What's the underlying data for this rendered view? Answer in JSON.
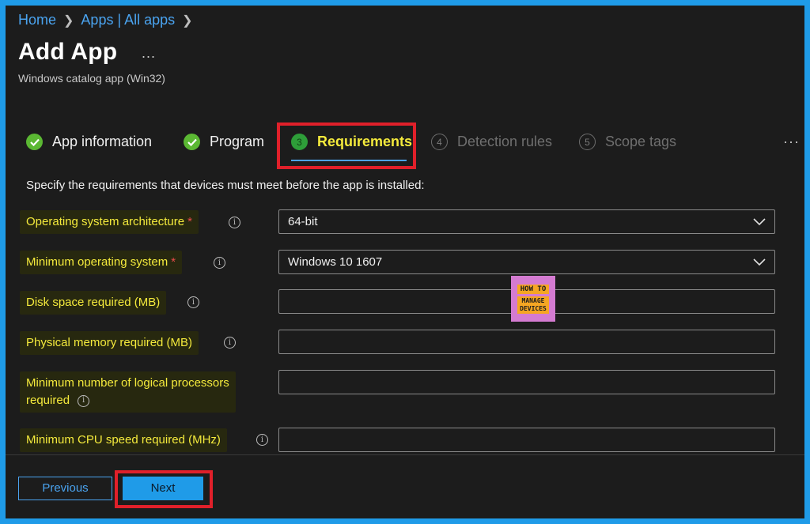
{
  "breadcrumb": {
    "home": "Home",
    "apps": "Apps | All apps"
  },
  "page": {
    "title": "Add App",
    "more": "...",
    "subtitle": "Windows catalog app (Win32)"
  },
  "tabs": [
    {
      "label": "App information",
      "state": "done"
    },
    {
      "label": "Program",
      "state": "done"
    },
    {
      "number": "3",
      "label": "Requirements",
      "state": "active"
    },
    {
      "number": "4",
      "label": "Detection rules",
      "state": "disabled"
    },
    {
      "number": "5",
      "label": "Scope tags",
      "state": "disabled"
    }
  ],
  "tabs_more": "···",
  "instructions": "Specify the requirements that devices must meet before the app is installed:",
  "fields": {
    "os_arch": {
      "label": "Operating system architecture",
      "required": "*",
      "value": "64-bit"
    },
    "min_os": {
      "label": "Minimum operating system",
      "required": "*",
      "value": "Windows 10 1607"
    },
    "disk_space": {
      "label": "Disk space required (MB)",
      "value": ""
    },
    "physical_memory": {
      "label": "Physical memory required (MB)",
      "value": ""
    },
    "logical_processors": {
      "label_line1": "Minimum number of logical processors",
      "label_line2": "required",
      "value": ""
    },
    "cpu_speed": {
      "label": "Minimum CPU speed required (MHz)",
      "value": ""
    }
  },
  "watermark": {
    "line1": "HOW TO",
    "line2": "MANAGE",
    "line3": "DEVICES"
  },
  "footer": {
    "previous": "Previous",
    "next": "Next"
  },
  "colors": {
    "accent": "#1f9be8",
    "highlight_text": "#f4ea3c",
    "annotation_red": "#e0202a",
    "success_green": "#5bb833"
  }
}
